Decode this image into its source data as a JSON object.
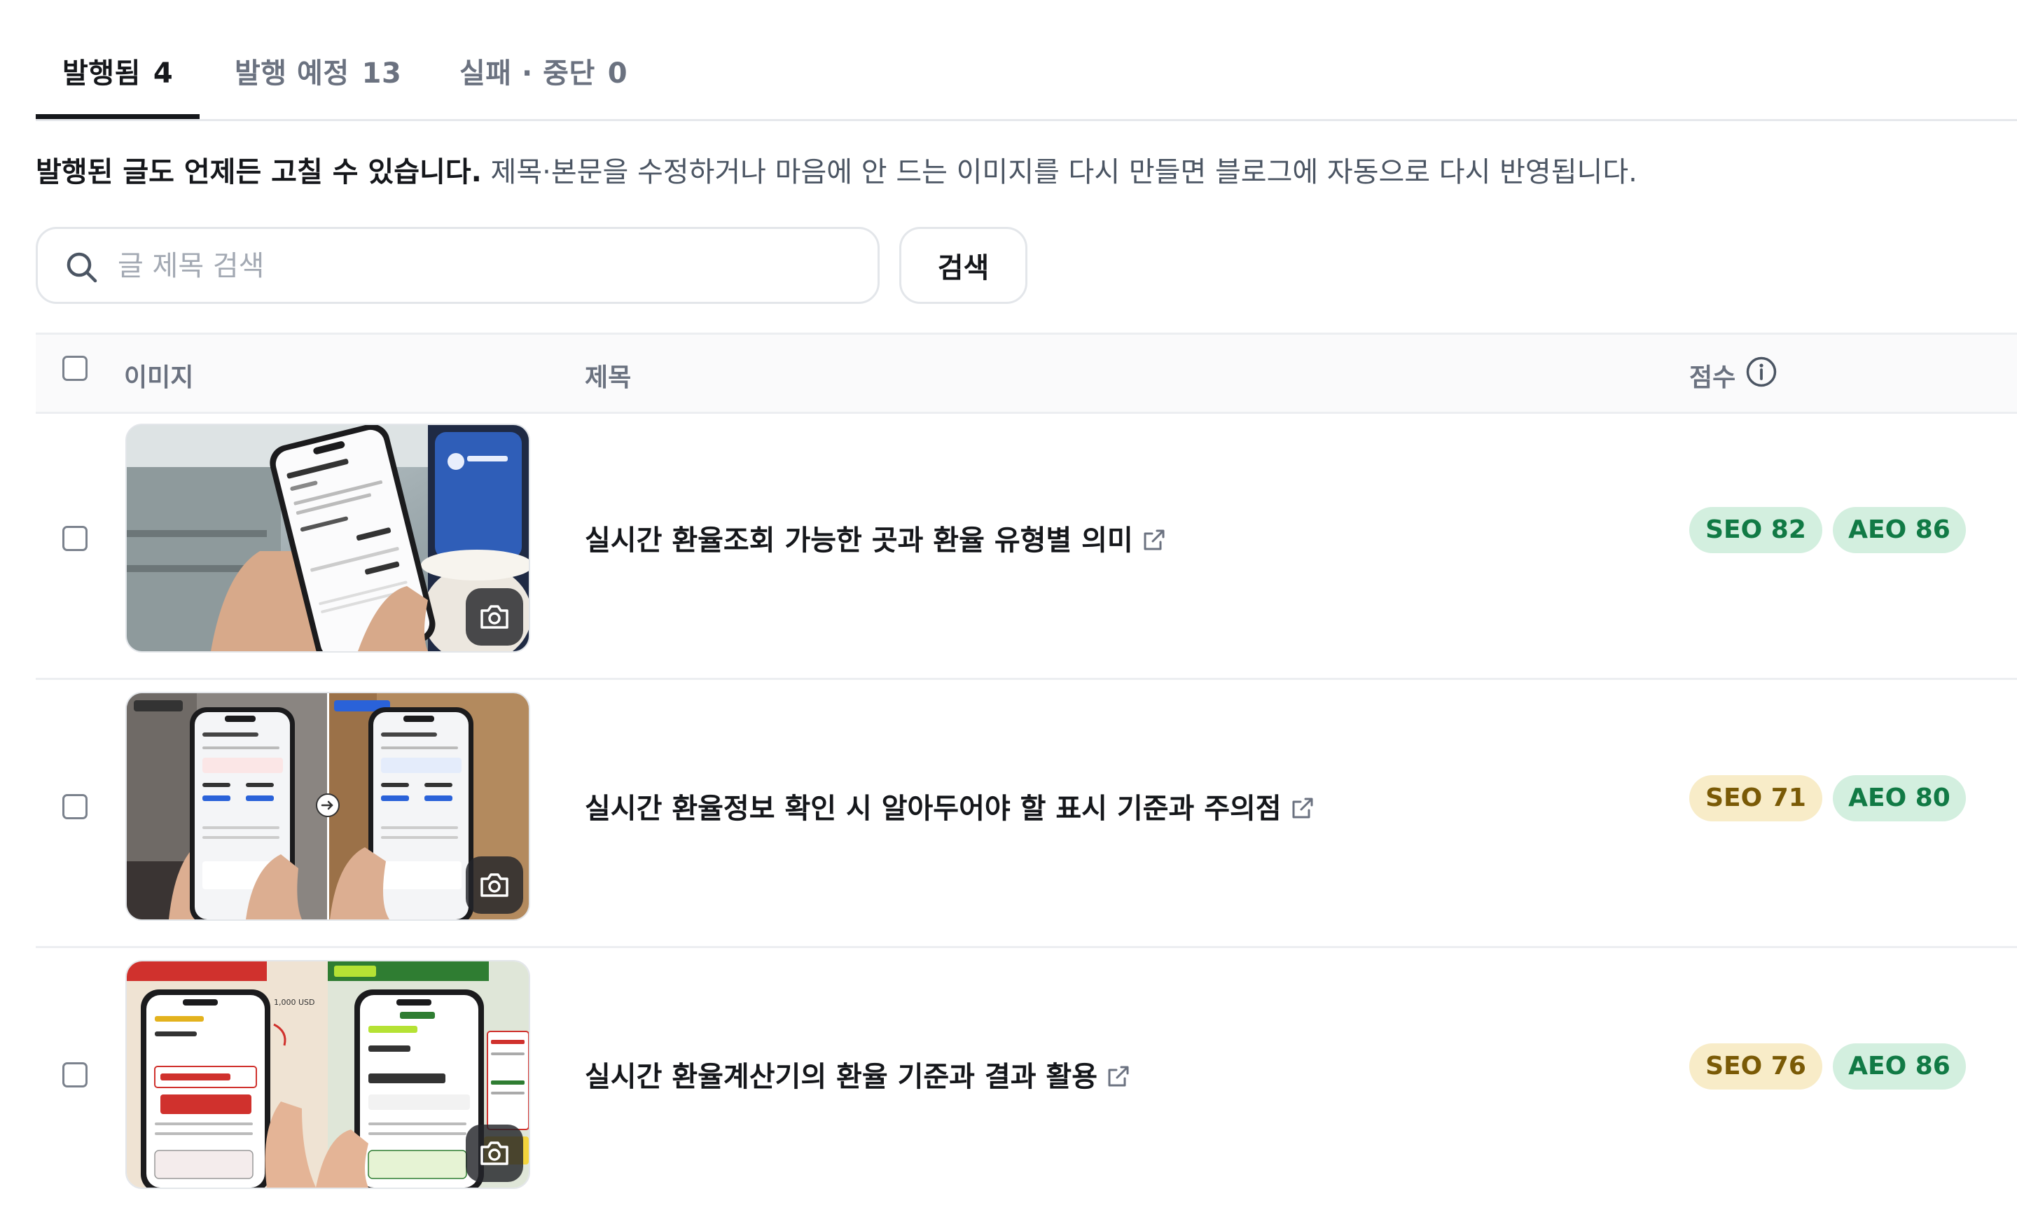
{
  "tabs": [
    {
      "label": "발행됨",
      "count": "4",
      "active": true
    },
    {
      "label": "발행 예정",
      "count": "13",
      "active": false
    },
    {
      "label": "실패 · 중단",
      "count": "0",
      "active": false
    }
  ],
  "notice": {
    "bold": "발행된 글도 언제든 고칠 수 있습니다.",
    "rest": " 제목·본문을 수정하거나 마음에 안 드는 이미지를 다시 만들면 블로그에 자동으로 다시 반영됩니다."
  },
  "search": {
    "placeholder": "글 제목 검색",
    "value": "",
    "button_label": "검색",
    "icon": "search-icon"
  },
  "table": {
    "headers": {
      "image": "이미지",
      "title": "제목",
      "score": "점수"
    },
    "rows": [
      {
        "title": "실시간 환율조회 가능한 곳과 환율 유형별 의미",
        "seo": "SEO 82",
        "aeo": "AEO 86",
        "seo_color": "green",
        "aeo_color": "green",
        "checked": false
      },
      {
        "title": "실시간 환율정보 확인 시 알아두어야 할 표시 기준과 주의점",
        "seo": "SEO 71",
        "aeo": "AEO 80",
        "seo_color": "yellow",
        "aeo_color": "green",
        "checked": false
      },
      {
        "title": "실시간 환율계산기의 환율 기준과 결과 활용",
        "seo": "SEO 76",
        "aeo": "AEO 86",
        "seo_color": "yellow",
        "aeo_color": "green",
        "checked": false
      }
    ]
  },
  "colors": {
    "badge_green_bg": "#d3efdf",
    "badge_green_text": "#117a45",
    "badge_yellow_bg": "#f8ecc8",
    "badge_yellow_text": "#7a5a06",
    "active_tab": "#15171b",
    "inactive_tab": "#6b7280"
  }
}
